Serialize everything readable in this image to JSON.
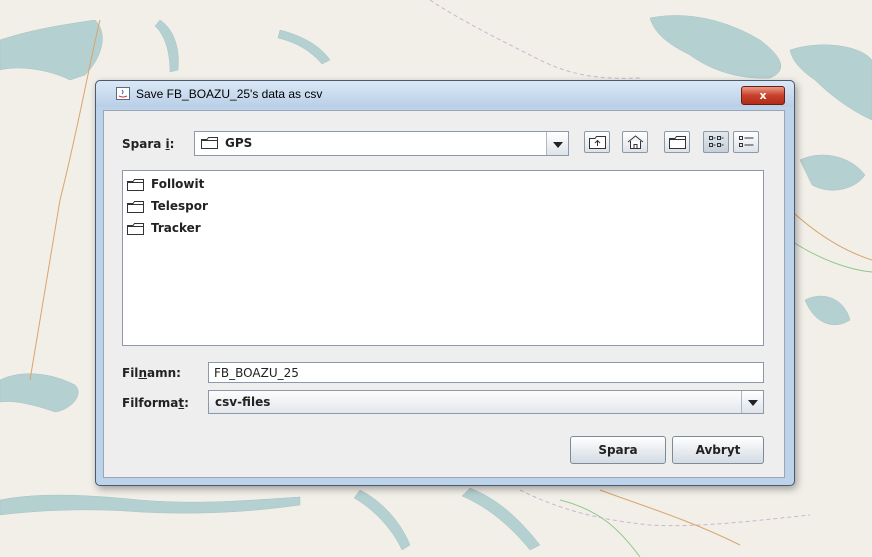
{
  "window": {
    "title": "Save FB_BOAZU_25's data as csv",
    "close_label": "x"
  },
  "look_in": {
    "label_pre": "Spara ",
    "label_mnemonic": "i",
    "label_post": ":",
    "value": "GPS"
  },
  "toolbar_icons": [
    "up-one-level-icon",
    "home-icon",
    "new-folder-icon",
    "list-view-icon",
    "details-view-icon"
  ],
  "files": [
    {
      "name": "Followit",
      "icon": "folder-icon"
    },
    {
      "name": "Telespor",
      "icon": "folder-icon"
    },
    {
      "name": "Tracker",
      "icon": "folder-icon"
    }
  ],
  "filename": {
    "label_pre": "Fil",
    "label_mnemonic": "n",
    "label_post": "amn:",
    "value": "FB_BOAZU_25"
  },
  "fileformat": {
    "label_pre": "Filforma",
    "label_mnemonic": "t",
    "label_post": ":",
    "value": "csv-files"
  },
  "buttons": {
    "save": "Spara",
    "cancel": "Avbryt"
  },
  "colors": {
    "map_background": "#f2efe9",
    "water": "#b5d0d0",
    "dialog_frame": "#bcd3ea",
    "close_button": "#c8402a"
  }
}
